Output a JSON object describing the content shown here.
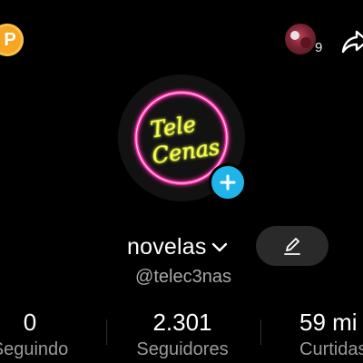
{
  "header": {
    "coin_letter": "P",
    "story_count": "9",
    "colors": {
      "coin": "#f5a623",
      "add": "#20b4ea"
    }
  },
  "profile": {
    "logo_line1": "Tele",
    "logo_line2": "Cenas",
    "username": "novelas",
    "handle": "@telec3nas"
  },
  "stats": [
    {
      "value": "0",
      "label": "Seguindo"
    },
    {
      "value": "2.301",
      "label": "Seguidores"
    },
    {
      "value": "59 mi",
      "label": "Curtidas"
    }
  ],
  "icons": [
    "coin-icon",
    "story-avatar",
    "share-icon",
    "add-icon",
    "chevron-down-icon",
    "edit-icon"
  ]
}
